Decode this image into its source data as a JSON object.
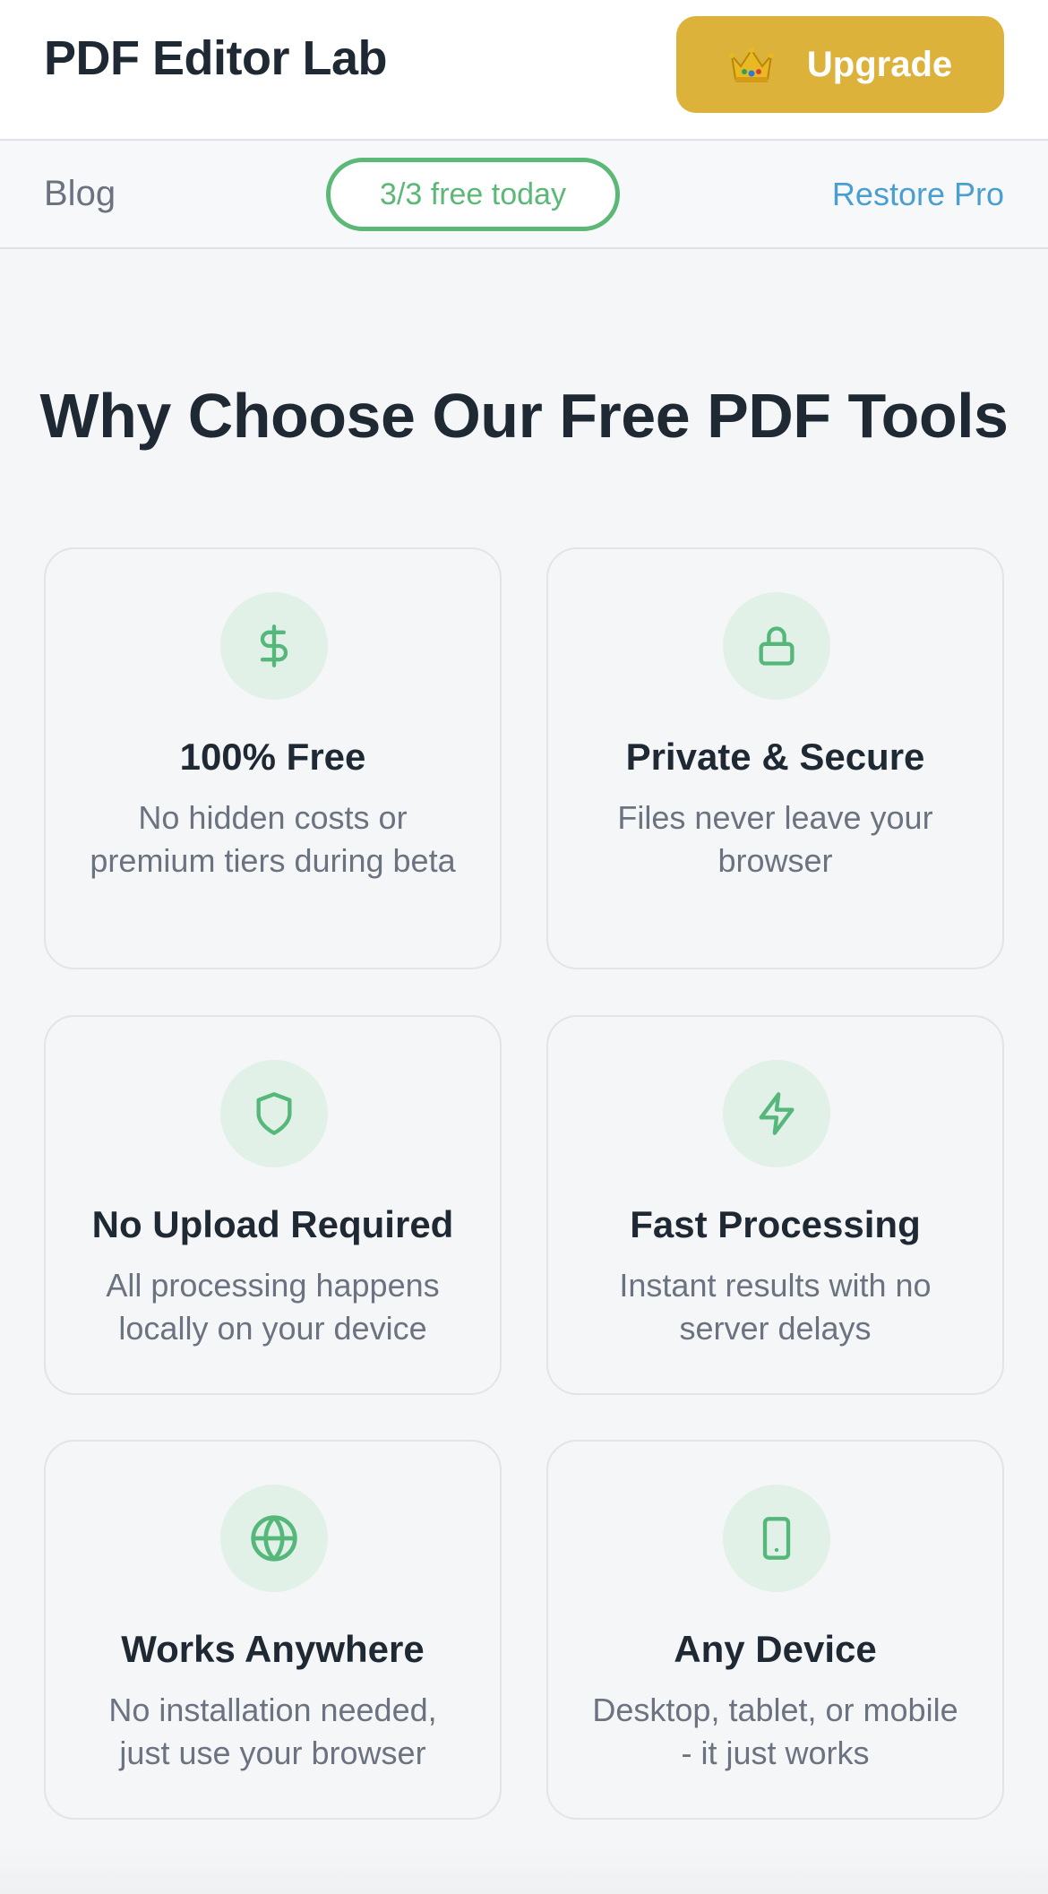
{
  "header": {
    "app_title": "PDF Editor Lab",
    "upgrade_label": "Upgrade",
    "upgrade_icon": "crown-icon",
    "accent_color": "#dcb23a"
  },
  "subnav": {
    "blog_label": "Blog",
    "free_badge": "3/3 free today",
    "restore_label": "Restore Pro",
    "badge_color": "#5bb876",
    "link_color": "#4a9fd1"
  },
  "features": {
    "title": "Why Choose Our Free PDF Tools",
    "items": [
      {
        "icon": "dollar-icon",
        "title": "100% Free",
        "desc": "No hidden costs or premium tiers during beta"
      },
      {
        "icon": "lock-icon",
        "title": "Private & Secure",
        "desc": "Files never leave your browser"
      },
      {
        "icon": "shield-icon",
        "title": "No Upload Required",
        "desc": "All processing happens locally on your device"
      },
      {
        "icon": "lightning-icon",
        "title": "Fast Processing",
        "desc": "Instant results with no server delays"
      },
      {
        "icon": "globe-icon",
        "title": "Works Anywhere",
        "desc": "No installation needed, just use your browser"
      },
      {
        "icon": "mobile-device-icon",
        "title": "Any Device",
        "desc": "Desktop, tablet, or mobile - it just works"
      }
    ]
  }
}
